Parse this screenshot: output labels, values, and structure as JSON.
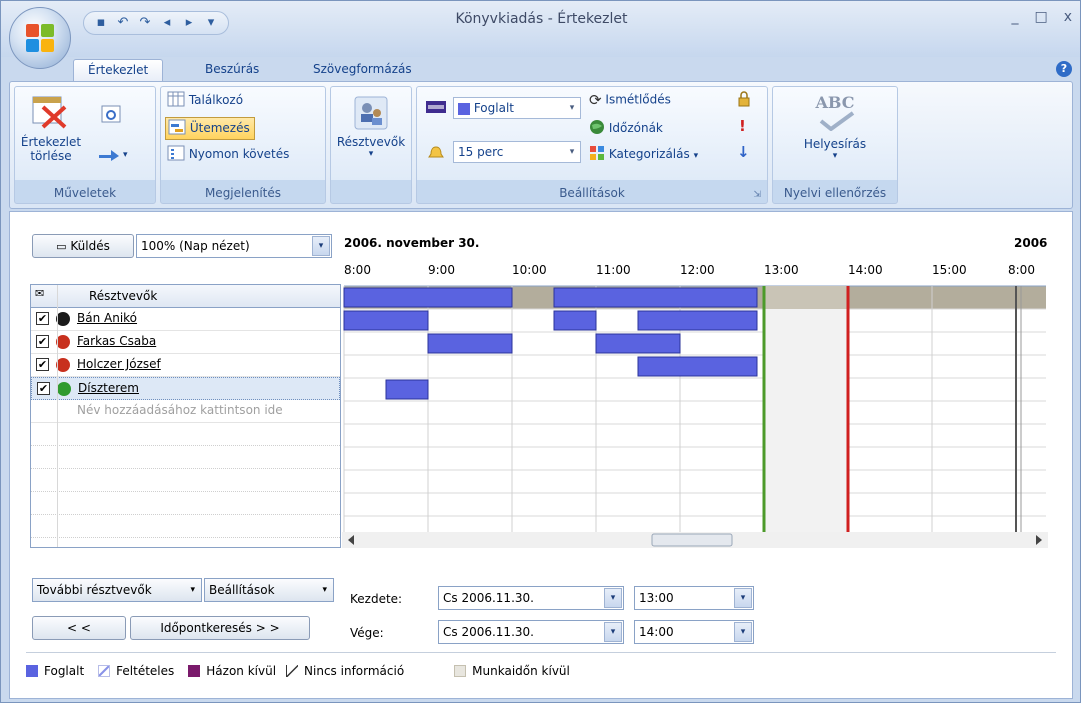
{
  "window": {
    "title": "Könyvkiadás - Értekezlet",
    "min": "_",
    "max": "□",
    "close": "x"
  },
  "qat": {
    "more": "▾"
  },
  "tabs": [
    "Értekezlet",
    "Beszúrás",
    "Szövegformázás"
  ],
  "help": "?",
  "ribbon": {
    "muveletek": {
      "label": "Műveletek",
      "delete_line1": "Értekezlet",
      "delete_line2": "törlése"
    },
    "megjelenites": {
      "label": "Megjelenítés",
      "talalkozo": "Találkozó",
      "utemezes": "Ütemezés",
      "nyomon": "Nyomon követés"
    },
    "resztvevok": {
      "label": "Résztvevők"
    },
    "beallitasok": {
      "label": "Beállítások",
      "show_as": "Foglalt",
      "reminder": "15 perc",
      "ismetlodes": "Ismétlődés",
      "idozonak": "Időzónák",
      "kategorizalas": "Kategorizálás"
    },
    "nyelvi": {
      "label": "Nyelvi ellenőrzés",
      "helyesiras": "Helyesírás",
      "abc": "ABC"
    }
  },
  "toolbar": {
    "send": "Küldés",
    "zoom": "100% (Nap nézet)"
  },
  "schedule": {
    "date": "2006. november 30.",
    "next_date": "2006",
    "hours": [
      "8:00",
      "9:00",
      "10:00",
      "11:00",
      "12:00",
      "13:00",
      "14:00",
      "15:00",
      "8:00"
    ]
  },
  "attendees": {
    "header": "Résztvevők",
    "items": [
      {
        "name": "Bán Anikó",
        "checked": true,
        "color": "#1b1b1b"
      },
      {
        "name": "Farkas Csaba",
        "checked": true,
        "color": "#c8301e"
      },
      {
        "name": "Holczer József",
        "checked": true,
        "color": "#c8301e"
      },
      {
        "name": "Díszterem",
        "checked": true,
        "color": "#2f9a2f"
      }
    ],
    "add_placeholder": "Név hozzáadásához kattintson ide"
  },
  "busy_blocks": [
    {
      "row": 0,
      "start": "8:00",
      "end": "10:00"
    },
    {
      "row": 0,
      "start": "10:30",
      "end": "12:55"
    },
    {
      "row": 1,
      "start": "8:00",
      "end": "9:00"
    },
    {
      "row": 1,
      "start": "10:30",
      "end": "11:00"
    },
    {
      "row": 1,
      "start": "11:30",
      "end": "12:55"
    },
    {
      "row": 2,
      "start": "9:00",
      "end": "10:00"
    },
    {
      "row": 2,
      "start": "11:00",
      "end": "12:00"
    },
    {
      "row": 3,
      "start": "11:30",
      "end": "12:55"
    },
    {
      "row": 4,
      "start": "8:30",
      "end": "9:00"
    }
  ],
  "meeting": {
    "start": "13:00",
    "end": "14:00"
  },
  "bottom": {
    "more_attendees": "További résztvevők",
    "options": "Beállítások",
    "back": "< <",
    "autopick": "Időpontkeresés > >",
    "start_label": "Kezdete:",
    "end_label": "Vége:",
    "start_date": "Cs 2006.11.30.",
    "start_time": "13:00",
    "end_date": "Cs 2006.11.30.",
    "end_time": "14:00"
  },
  "legend": {
    "busy": "Foglalt",
    "tentative": "Feltételes",
    "oof": "Házon kívül",
    "noinfo": "Nincs információ",
    "offhours": "Munkaidőn kívül"
  },
  "colors": {
    "busy": "#5a63e0",
    "oof": "#7a1a6b",
    "offhours": "#b3ad9c",
    "start_line": "#4c9a2a",
    "end_line": "#d02020"
  }
}
